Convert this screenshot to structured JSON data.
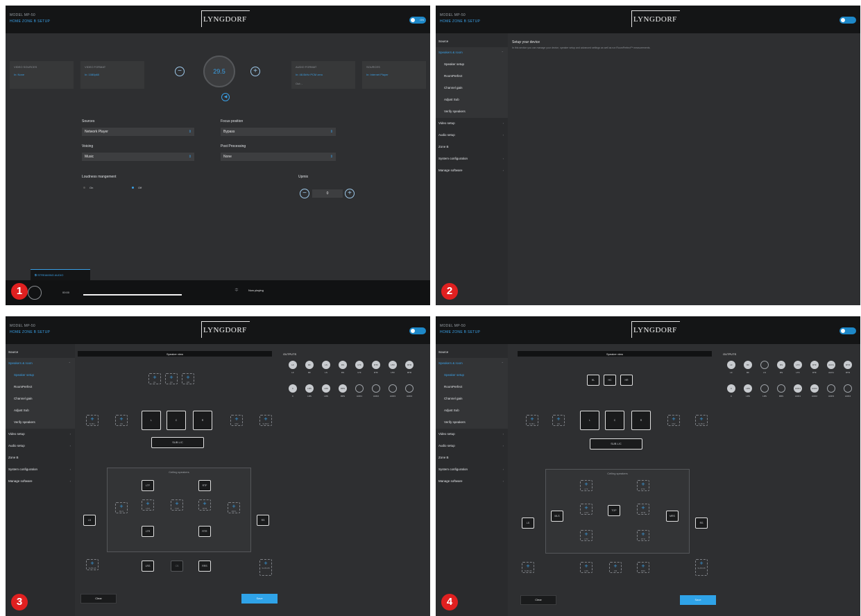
{
  "brand": {
    "logo": "LYNGDORF",
    "model": "MODEL MP-50",
    "breadcrumb": "HOME  ZONE B  SETUP",
    "toggle": "ON"
  },
  "badges": [
    "1",
    "2",
    "3",
    "4"
  ],
  "panel1": {
    "video_sources_label": "VIDEO SOURCES",
    "video_sources_value": "In: None",
    "video_format_label": "VIDEO FORMAT",
    "video_format_value": "In: 1080p60",
    "volume": "29.5",
    "audio_format_label": "AUDIO FORMAT",
    "audio_format_value": "In: 48.0kHz PCM zero",
    "audio_format_sub": "Out: -",
    "sources_out_label": "SOURCES",
    "sources_out_value": "In: Internet Player",
    "sources": {
      "label": "Sources",
      "value": "Network Player"
    },
    "focus": {
      "label": "Focus position",
      "value": "Bypass"
    },
    "voicing": {
      "label": "Voicing",
      "value": "Music"
    },
    "post": {
      "label": "Post Processing",
      "value": "None"
    },
    "loudness": {
      "label": "Loudness mangement",
      "on": "On",
      "off": "Off"
    },
    "upmix": {
      "label": "Upmix",
      "value": "0"
    },
    "tab": "STREAMING AUDIO",
    "time": "00:00",
    "now_playing": "Now playing"
  },
  "sidebar": {
    "source": "Source",
    "speakers_room": "Speakers & room",
    "speaker_setup": "Speaker setup",
    "roomperfect": "RoomPerfect",
    "channel_gain": "Channel gain",
    "adjust_sub": "Adjust Sub",
    "verify": "Verify speakers",
    "video_setup": "Video setup",
    "audio_setup": "Audio setup",
    "zone_b": "Zone B",
    "system_config": "System configuration",
    "manage_software": "Manage software"
  },
  "panel2": {
    "heading": "Setup your device",
    "desc": "In this section you can manage your device, speaker setup and advanced settings as well as run RoomPerfect™ measurements."
  },
  "speaker_view": {
    "title": "Speaker view",
    "outputs_label": "OUTPUTS",
    "ceiling_label": "Ceiling speakers",
    "sub_lr": "SUB L/C",
    "clear": "Clear",
    "save": "Save",
    "p3_outputs_row1": [
      "LF",
      "RF",
      "LS",
      "RS",
      "LTF",
      "RTF",
      "LTR",
      "RTR"
    ],
    "p3_outputs_row2": [
      "C",
      "LRS",
      "LRS",
      "RRS",
      "AUD1",
      "AUD2",
      "AUD3",
      "AUD4"
    ],
    "p3_outputs_row1_filled": [
      true,
      true,
      true,
      true,
      true,
      true,
      true,
      true
    ],
    "p3_outputs_row2_filled": [
      true,
      true,
      true,
      true,
      false,
      false,
      false,
      false
    ],
    "p4_outputs_row1": [
      "LF",
      "RF",
      "LS",
      "RS",
      "LTF",
      "RTF",
      "AUX1",
      "RTR"
    ],
    "p4_outputs_row2": [
      "C",
      "LRS",
      "LRS",
      "RRS",
      "AUD1",
      "AUD2",
      "AUD3",
      "AUD4"
    ],
    "p4_outputs_row1_filled": [
      true,
      true,
      false,
      true,
      true,
      true,
      true,
      true
    ],
    "p4_outputs_row2_filled": [
      true,
      true,
      false,
      false,
      true,
      true,
      false,
      false
    ],
    "p3": {
      "top": [
        "HL",
        "HC",
        "HR"
      ],
      "front": [
        "L",
        "C",
        "R"
      ],
      "wide_l": "SUB L",
      "side_l": "LW",
      "side_r": "RW",
      "wide_r": "SUB R",
      "ceil_top": [
        "LTF",
        "RTF"
      ],
      "ceil_bottom": [
        "LTR",
        "RTR"
      ],
      "ceil_mid": [
        "MLS",
        "LTM",
        "TOP",
        "RTM",
        "MRS"
      ],
      "ls": "LS",
      "rs": "RS",
      "rear": [
        "LRS",
        "CB",
        "RRS"
      ],
      "sub_lb": "SUB LB",
      "sub_rb": "SUB RB"
    },
    "p4": {
      "top": [
        "HL",
        "HC",
        "HR"
      ],
      "front": [
        "L",
        "C",
        "R"
      ],
      "wide_l": "SUB L",
      "side_l": "LW",
      "side_r": "RW",
      "wide_r": "SUB R",
      "ceil_top": [
        "LTF",
        "RTF"
      ],
      "ceil_mid": [
        "MLS",
        "LTM",
        "TOP",
        "RTM",
        "MRS"
      ],
      "ceil_bottom": [
        "LTR",
        "RTR"
      ],
      "ls": "LS",
      "rs": "RS",
      "rear": [
        "LRS",
        "CB",
        "RRS"
      ],
      "sub_lb": "SUB LB",
      "sub_rb": "SUB RB"
    }
  }
}
